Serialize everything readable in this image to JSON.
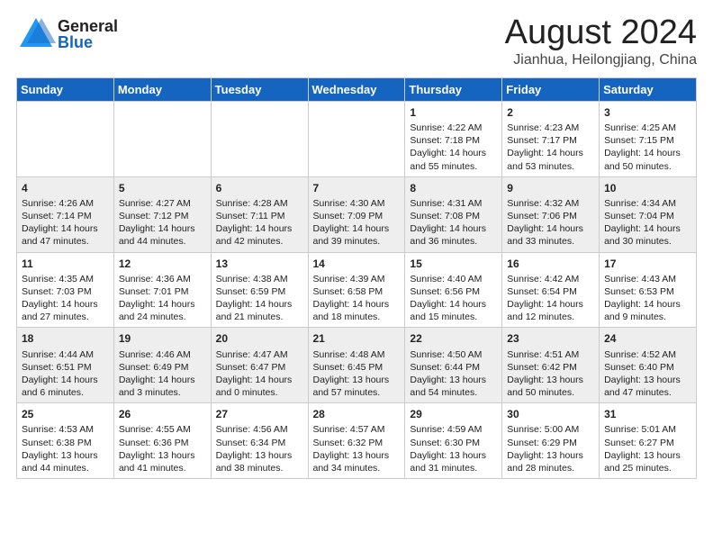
{
  "header": {
    "logo_general": "General",
    "logo_blue": "Blue",
    "main_title": "August 2024",
    "subtitle": "Jianhua, Heilongjiang, China"
  },
  "days_of_week": [
    "Sunday",
    "Monday",
    "Tuesday",
    "Wednesday",
    "Thursday",
    "Friday",
    "Saturday"
  ],
  "weeks": [
    [
      {
        "day": "",
        "content": ""
      },
      {
        "day": "",
        "content": ""
      },
      {
        "day": "",
        "content": ""
      },
      {
        "day": "",
        "content": ""
      },
      {
        "day": "1",
        "content": "Sunrise: 4:22 AM\nSunset: 7:18 PM\nDaylight: 14 hours\nand 55 minutes."
      },
      {
        "day": "2",
        "content": "Sunrise: 4:23 AM\nSunset: 7:17 PM\nDaylight: 14 hours\nand 53 minutes."
      },
      {
        "day": "3",
        "content": "Sunrise: 4:25 AM\nSunset: 7:15 PM\nDaylight: 14 hours\nand 50 minutes."
      }
    ],
    [
      {
        "day": "4",
        "content": "Sunrise: 4:26 AM\nSunset: 7:14 PM\nDaylight: 14 hours\nand 47 minutes."
      },
      {
        "day": "5",
        "content": "Sunrise: 4:27 AM\nSunset: 7:12 PM\nDaylight: 14 hours\nand 44 minutes."
      },
      {
        "day": "6",
        "content": "Sunrise: 4:28 AM\nSunset: 7:11 PM\nDaylight: 14 hours\nand 42 minutes."
      },
      {
        "day": "7",
        "content": "Sunrise: 4:30 AM\nSunset: 7:09 PM\nDaylight: 14 hours\nand 39 minutes."
      },
      {
        "day": "8",
        "content": "Sunrise: 4:31 AM\nSunset: 7:08 PM\nDaylight: 14 hours\nand 36 minutes."
      },
      {
        "day": "9",
        "content": "Sunrise: 4:32 AM\nSunset: 7:06 PM\nDaylight: 14 hours\nand 33 minutes."
      },
      {
        "day": "10",
        "content": "Sunrise: 4:34 AM\nSunset: 7:04 PM\nDaylight: 14 hours\nand 30 minutes."
      }
    ],
    [
      {
        "day": "11",
        "content": "Sunrise: 4:35 AM\nSunset: 7:03 PM\nDaylight: 14 hours\nand 27 minutes."
      },
      {
        "day": "12",
        "content": "Sunrise: 4:36 AM\nSunset: 7:01 PM\nDaylight: 14 hours\nand 24 minutes."
      },
      {
        "day": "13",
        "content": "Sunrise: 4:38 AM\nSunset: 6:59 PM\nDaylight: 14 hours\nand 21 minutes."
      },
      {
        "day": "14",
        "content": "Sunrise: 4:39 AM\nSunset: 6:58 PM\nDaylight: 14 hours\nand 18 minutes."
      },
      {
        "day": "15",
        "content": "Sunrise: 4:40 AM\nSunset: 6:56 PM\nDaylight: 14 hours\nand 15 minutes."
      },
      {
        "day": "16",
        "content": "Sunrise: 4:42 AM\nSunset: 6:54 PM\nDaylight: 14 hours\nand 12 minutes."
      },
      {
        "day": "17",
        "content": "Sunrise: 4:43 AM\nSunset: 6:53 PM\nDaylight: 14 hours\nand 9 minutes."
      }
    ],
    [
      {
        "day": "18",
        "content": "Sunrise: 4:44 AM\nSunset: 6:51 PM\nDaylight: 14 hours\nand 6 minutes."
      },
      {
        "day": "19",
        "content": "Sunrise: 4:46 AM\nSunset: 6:49 PM\nDaylight: 14 hours\nand 3 minutes."
      },
      {
        "day": "20",
        "content": "Sunrise: 4:47 AM\nSunset: 6:47 PM\nDaylight: 14 hours\nand 0 minutes."
      },
      {
        "day": "21",
        "content": "Sunrise: 4:48 AM\nSunset: 6:45 PM\nDaylight: 13 hours\nand 57 minutes."
      },
      {
        "day": "22",
        "content": "Sunrise: 4:50 AM\nSunset: 6:44 PM\nDaylight: 13 hours\nand 54 minutes."
      },
      {
        "day": "23",
        "content": "Sunrise: 4:51 AM\nSunset: 6:42 PM\nDaylight: 13 hours\nand 50 minutes."
      },
      {
        "day": "24",
        "content": "Sunrise: 4:52 AM\nSunset: 6:40 PM\nDaylight: 13 hours\nand 47 minutes."
      }
    ],
    [
      {
        "day": "25",
        "content": "Sunrise: 4:53 AM\nSunset: 6:38 PM\nDaylight: 13 hours\nand 44 minutes."
      },
      {
        "day": "26",
        "content": "Sunrise: 4:55 AM\nSunset: 6:36 PM\nDaylight: 13 hours\nand 41 minutes."
      },
      {
        "day": "27",
        "content": "Sunrise: 4:56 AM\nSunset: 6:34 PM\nDaylight: 13 hours\nand 38 minutes."
      },
      {
        "day": "28",
        "content": "Sunrise: 4:57 AM\nSunset: 6:32 PM\nDaylight: 13 hours\nand 34 minutes."
      },
      {
        "day": "29",
        "content": "Sunrise: 4:59 AM\nSunset: 6:30 PM\nDaylight: 13 hours\nand 31 minutes."
      },
      {
        "day": "30",
        "content": "Sunrise: 5:00 AM\nSunset: 6:29 PM\nDaylight: 13 hours\nand 28 minutes."
      },
      {
        "day": "31",
        "content": "Sunrise: 5:01 AM\nSunset: 6:27 PM\nDaylight: 13 hours\nand 25 minutes."
      }
    ]
  ]
}
